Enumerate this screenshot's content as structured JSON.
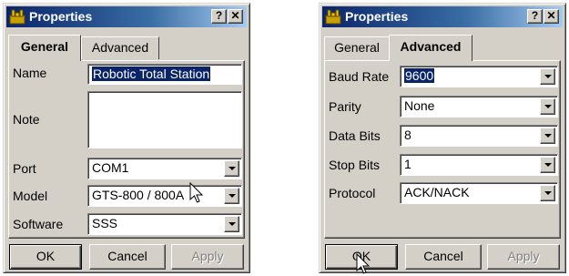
{
  "left_dialog": {
    "title": "Properties",
    "help_label": "?",
    "close_label": "✕",
    "tabs": [
      "General",
      "Advanced"
    ],
    "active_tab": "General",
    "fields": {
      "name_label": "Name",
      "name_value": "Robotic Total Station",
      "note_label": "Note",
      "note_value": "",
      "port_label": "Port",
      "port_value": "COM1",
      "model_label": "Model",
      "model_value": "GTS-800 / 800A",
      "software_label": "Software",
      "software_value": "SSS"
    },
    "buttons": {
      "ok": "OK",
      "cancel": "Cancel",
      "apply": "Apply"
    }
  },
  "right_dialog": {
    "title": "Properties",
    "help_label": "?",
    "close_label": "✕",
    "tabs": [
      "General",
      "Advanced"
    ],
    "active_tab": "Advanced",
    "fields": {
      "baud_label": "Baud Rate",
      "baud_value": "9600",
      "parity_label": "Parity",
      "parity_value": "None",
      "databits_label": "Data Bits",
      "databits_value": "8",
      "stopbits_label": "Stop Bits",
      "stopbits_value": "1",
      "protocol_label": "Protocol",
      "protocol_value": "ACK/NACK"
    },
    "buttons": {
      "ok": "OK",
      "cancel": "Cancel",
      "apply": "Apply"
    }
  },
  "colors": {
    "titlebar_start": "#0a246a",
    "titlebar_end": "#a6caf0",
    "face": "#d4d0c8",
    "selection": "#0a246a"
  }
}
